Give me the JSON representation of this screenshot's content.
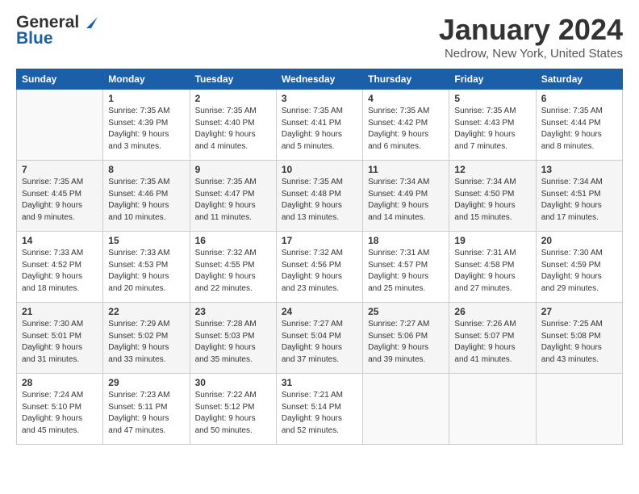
{
  "logo": {
    "line1": "General",
    "line2": "Blue"
  },
  "title": "January 2024",
  "location": "Nedrow, New York, United States",
  "headers": [
    "Sunday",
    "Monday",
    "Tuesday",
    "Wednesday",
    "Thursday",
    "Friday",
    "Saturday"
  ],
  "weeks": [
    [
      {
        "day": "",
        "info": ""
      },
      {
        "day": "1",
        "info": "Sunrise: 7:35 AM\nSunset: 4:39 PM\nDaylight: 9 hours\nand 3 minutes."
      },
      {
        "day": "2",
        "info": "Sunrise: 7:35 AM\nSunset: 4:40 PM\nDaylight: 9 hours\nand 4 minutes."
      },
      {
        "day": "3",
        "info": "Sunrise: 7:35 AM\nSunset: 4:41 PM\nDaylight: 9 hours\nand 5 minutes."
      },
      {
        "day": "4",
        "info": "Sunrise: 7:35 AM\nSunset: 4:42 PM\nDaylight: 9 hours\nand 6 minutes."
      },
      {
        "day": "5",
        "info": "Sunrise: 7:35 AM\nSunset: 4:43 PM\nDaylight: 9 hours\nand 7 minutes."
      },
      {
        "day": "6",
        "info": "Sunrise: 7:35 AM\nSunset: 4:44 PM\nDaylight: 9 hours\nand 8 minutes."
      }
    ],
    [
      {
        "day": "7",
        "info": "Sunrise: 7:35 AM\nSunset: 4:45 PM\nDaylight: 9 hours\nand 9 minutes."
      },
      {
        "day": "8",
        "info": "Sunrise: 7:35 AM\nSunset: 4:46 PM\nDaylight: 9 hours\nand 10 minutes."
      },
      {
        "day": "9",
        "info": "Sunrise: 7:35 AM\nSunset: 4:47 PM\nDaylight: 9 hours\nand 11 minutes."
      },
      {
        "day": "10",
        "info": "Sunrise: 7:35 AM\nSunset: 4:48 PM\nDaylight: 9 hours\nand 13 minutes."
      },
      {
        "day": "11",
        "info": "Sunrise: 7:34 AM\nSunset: 4:49 PM\nDaylight: 9 hours\nand 14 minutes."
      },
      {
        "day": "12",
        "info": "Sunrise: 7:34 AM\nSunset: 4:50 PM\nDaylight: 9 hours\nand 15 minutes."
      },
      {
        "day": "13",
        "info": "Sunrise: 7:34 AM\nSunset: 4:51 PM\nDaylight: 9 hours\nand 17 minutes."
      }
    ],
    [
      {
        "day": "14",
        "info": "Sunrise: 7:33 AM\nSunset: 4:52 PM\nDaylight: 9 hours\nand 18 minutes."
      },
      {
        "day": "15",
        "info": "Sunrise: 7:33 AM\nSunset: 4:53 PM\nDaylight: 9 hours\nand 20 minutes."
      },
      {
        "day": "16",
        "info": "Sunrise: 7:32 AM\nSunset: 4:55 PM\nDaylight: 9 hours\nand 22 minutes."
      },
      {
        "day": "17",
        "info": "Sunrise: 7:32 AM\nSunset: 4:56 PM\nDaylight: 9 hours\nand 23 minutes."
      },
      {
        "day": "18",
        "info": "Sunrise: 7:31 AM\nSunset: 4:57 PM\nDaylight: 9 hours\nand 25 minutes."
      },
      {
        "day": "19",
        "info": "Sunrise: 7:31 AM\nSunset: 4:58 PM\nDaylight: 9 hours\nand 27 minutes."
      },
      {
        "day": "20",
        "info": "Sunrise: 7:30 AM\nSunset: 4:59 PM\nDaylight: 9 hours\nand 29 minutes."
      }
    ],
    [
      {
        "day": "21",
        "info": "Sunrise: 7:30 AM\nSunset: 5:01 PM\nDaylight: 9 hours\nand 31 minutes."
      },
      {
        "day": "22",
        "info": "Sunrise: 7:29 AM\nSunset: 5:02 PM\nDaylight: 9 hours\nand 33 minutes."
      },
      {
        "day": "23",
        "info": "Sunrise: 7:28 AM\nSunset: 5:03 PM\nDaylight: 9 hours\nand 35 minutes."
      },
      {
        "day": "24",
        "info": "Sunrise: 7:27 AM\nSunset: 5:04 PM\nDaylight: 9 hours\nand 37 minutes."
      },
      {
        "day": "25",
        "info": "Sunrise: 7:27 AM\nSunset: 5:06 PM\nDaylight: 9 hours\nand 39 minutes."
      },
      {
        "day": "26",
        "info": "Sunrise: 7:26 AM\nSunset: 5:07 PM\nDaylight: 9 hours\nand 41 minutes."
      },
      {
        "day": "27",
        "info": "Sunrise: 7:25 AM\nSunset: 5:08 PM\nDaylight: 9 hours\nand 43 minutes."
      }
    ],
    [
      {
        "day": "28",
        "info": "Sunrise: 7:24 AM\nSunset: 5:10 PM\nDaylight: 9 hours\nand 45 minutes."
      },
      {
        "day": "29",
        "info": "Sunrise: 7:23 AM\nSunset: 5:11 PM\nDaylight: 9 hours\nand 47 minutes."
      },
      {
        "day": "30",
        "info": "Sunrise: 7:22 AM\nSunset: 5:12 PM\nDaylight: 9 hours\nand 50 minutes."
      },
      {
        "day": "31",
        "info": "Sunrise: 7:21 AM\nSunset: 5:14 PM\nDaylight: 9 hours\nand 52 minutes."
      },
      {
        "day": "",
        "info": ""
      },
      {
        "day": "",
        "info": ""
      },
      {
        "day": "",
        "info": ""
      }
    ]
  ]
}
